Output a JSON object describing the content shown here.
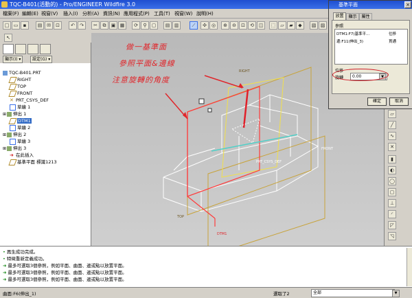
{
  "window": {
    "title": "TQC-B401(活動的) - Pro/ENGINEER Wildfire 3.0"
  },
  "menubar": [
    "檔案(F)",
    "編輯(E)",
    "視窗(V)",
    "插入(I)",
    "分析(A)",
    "資訊(N)",
    "應用程式(P)",
    "工具(T)",
    "視窗(W)",
    "說明(H)"
  ],
  "left_panel": {
    "filter_buttons": [
      "顯示(I) ▾",
      "設定(G) ▾"
    ],
    "tree": [
      {
        "label": "TQC-B401.PRT",
        "icon": "part-icon"
      },
      {
        "label": "RIGHT",
        "icon": "datum-plane-icon"
      },
      {
        "label": "TOP",
        "icon": "datum-plane-icon"
      },
      {
        "label": "FRONT",
        "icon": "datum-plane-icon"
      },
      {
        "label": "PRT_CSYS_DEF",
        "icon": "csys-icon"
      },
      {
        "label": "草繪 1",
        "icon": "sketch-icon"
      },
      {
        "label": "伸出 1",
        "icon": "extrude-icon"
      },
      {
        "label": "DTM1",
        "icon": "datum-plane-icon",
        "selected": true
      },
      {
        "label": "草繪 2",
        "icon": "sketch-icon"
      },
      {
        "label": "伸出 2",
        "icon": "extrude-icon"
      },
      {
        "label": "草繪 3",
        "icon": "sketch-icon"
      },
      {
        "label": "伸出 3",
        "icon": "extrude-icon"
      },
      {
        "label": "在此插入",
        "icon": "insert-arrow-icon"
      },
      {
        "label": "基準平面 標識1213",
        "icon": "datum-plane-icon"
      }
    ]
  },
  "annotation": {
    "line1": "做一基準面",
    "line2": "參照平面&邊線",
    "line3": "注意旋轉的角度"
  },
  "model_labels": {
    "right": "RIGHT",
    "front": "FRONT",
    "dtm1": "DTM1",
    "csys": "PRT_CSYS_DEF",
    "top": "TOP"
  },
  "dialog": {
    "title": "基準平面",
    "tabs": [
      "放置",
      "顯示",
      "屬性"
    ],
    "section_label": "參照",
    "refs": [
      {
        "name": "DTM1:F7(基準平...",
        "type": "位移"
      },
      {
        "name": "邊:F11(伸出_3)",
        "type": "貫通"
      }
    ],
    "offset_label": "位移",
    "rotate_label": "旋轉",
    "rotate_value": "0.00",
    "ok_label": "確定",
    "cancel_label": "取消"
  },
  "messages": [
    "再生成功完成。",
    "特徵重新定義成功。",
    "最多可選取3個參照，例如平面、曲面、邊或點以放置平面。",
    "最多可選取3個參照，例如平面、曲面、邊或點以放置平面。",
    "最多可選取3個參照，例如平面、曲面、邊或點以放置平面。",
    "最多可選取3個參照，例如平面、曲面、邊或點以放置平面。"
  ],
  "status": {
    "left": "曲面:F6(伸出_1)",
    "selected": "選取了2",
    "filter": "全部"
  },
  "colors": {
    "annotation": "#e0262b",
    "highlight": "#ff3b3b",
    "datum": "#c8a33a",
    "edge": "#ffffff"
  }
}
